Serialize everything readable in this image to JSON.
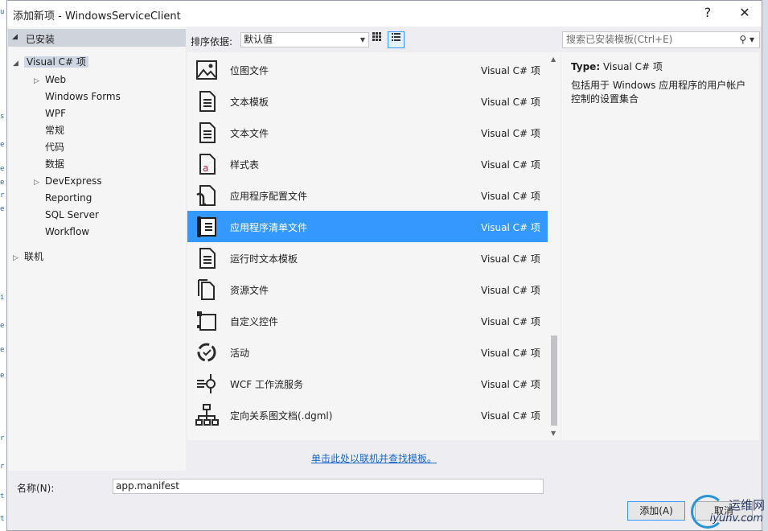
{
  "dialog": {
    "title": "添加新项 - WindowsServiceClient",
    "help_label": "?",
    "close_label": "✕"
  },
  "tree": {
    "installed_label": "已安装",
    "items": [
      {
        "label": "Visual C# 项",
        "expander": "◢",
        "selected": true
      },
      {
        "label": "Web",
        "expander": "▷"
      },
      {
        "label": "Windows Forms",
        "expander": ""
      },
      {
        "label": "WPF",
        "expander": ""
      },
      {
        "label": "常规",
        "expander": ""
      },
      {
        "label": "代码",
        "expander": ""
      },
      {
        "label": "数据",
        "expander": ""
      },
      {
        "label": "DevExpress",
        "expander": "▷"
      },
      {
        "label": "Reporting",
        "expander": ""
      },
      {
        "label": "SQL Server",
        "expander": ""
      },
      {
        "label": "Workflow",
        "expander": ""
      }
    ],
    "online_label": "联机",
    "online_expander": "▷"
  },
  "toolbar": {
    "sort_label": "排序依据:",
    "sort_value": "默认值",
    "search_placeholder": "搜索已安装模板(Ctrl+E)"
  },
  "templates": [
    {
      "name": "位图文件",
      "category": "Visual C# 项",
      "icon": "bitmap-icon"
    },
    {
      "name": "文本模板",
      "category": "Visual C# 项",
      "icon": "text-template-icon"
    },
    {
      "name": "文本文件",
      "category": "Visual C# 项",
      "icon": "text-file-icon"
    },
    {
      "name": "样式表",
      "category": "Visual C# 项",
      "icon": "stylesheet-icon"
    },
    {
      "name": "应用程序配置文件",
      "category": "Visual C# 项",
      "icon": "config-file-icon"
    },
    {
      "name": "应用程序清单文件",
      "category": "Visual C# 项",
      "icon": "manifest-file-icon",
      "selected": true
    },
    {
      "name": "运行时文本模板",
      "category": "Visual C# 项",
      "icon": "runtime-text-template-icon"
    },
    {
      "name": "资源文件",
      "category": "Visual C# 项",
      "icon": "resource-file-icon"
    },
    {
      "name": "自定义控件",
      "category": "Visual C# 项",
      "icon": "custom-control-icon"
    },
    {
      "name": "活动",
      "category": "Visual C# 项",
      "icon": "activity-icon"
    },
    {
      "name": "WCF 工作流服务",
      "category": "Visual C# 项",
      "icon": "wcf-workflow-icon"
    },
    {
      "name": "定向关系图文档(.dgml)",
      "category": "Visual C# 项",
      "icon": "dgml-icon"
    }
  ],
  "detail": {
    "type_label": "Type:",
    "type_value": "Visual C# 项",
    "description": "包括用于 Windows 应用程序的用户帐户控制的设置集合"
  },
  "online_link": "单击此处以联机并查找模板。",
  "name_field": {
    "label": "名称(N):",
    "value": "app.manifest"
  },
  "buttons": {
    "add": "添加(A)",
    "cancel": "取消"
  },
  "watermark": {
    "line1": "运维网",
    "line2": "iyunv.com"
  },
  "colors": {
    "selection": "#3399ff",
    "link": "#1a67c7"
  }
}
